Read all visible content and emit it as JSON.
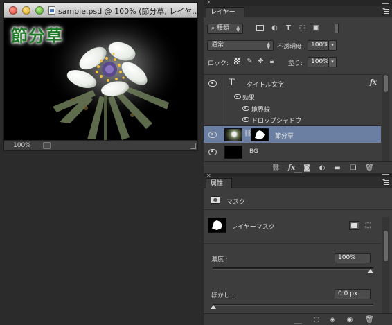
{
  "document": {
    "title": "sample.psd @ 100% (節分草, レイヤ…",
    "canvas_text": "節分草",
    "zoom": "100%"
  },
  "layers_panel": {
    "tab_label": "レイヤー",
    "filter_kind": "種類",
    "blend_mode": "通常",
    "opacity_label": "不透明度:",
    "opacity_value": "100%",
    "lock_label": "ロック:",
    "fill_label": "塗り:",
    "fill_value": "100%",
    "layers": [
      {
        "name": "タイトル文字",
        "kind": "text",
        "fx": "fx",
        "effects_label": "効果",
        "effects": [
          "境界線",
          "ドロップシャドウ"
        ]
      },
      {
        "name": "節分草",
        "kind": "image-with-mask",
        "selected": true
      },
      {
        "name": "BG",
        "kind": "fill"
      }
    ]
  },
  "properties_panel": {
    "tab_label": "属性",
    "title": "マスク",
    "mask_name": "レイヤーマスク",
    "density_label": "濃度 :",
    "density_value": "100%",
    "feather_label": "ぼかし :",
    "feather_value": "0.0 px"
  },
  "colors": {
    "selected_row": "#6b7fa3",
    "panel_bg": "#3d3d3d",
    "canvas_text": "#1f7a28"
  },
  "icons": {
    "doc_controls": [
      "close-icon",
      "minimize-icon",
      "zoom-icon"
    ],
    "filter": [
      "image-filter-icon",
      "adjustment-filter-icon",
      "type-filter-icon",
      "shape-filter-icon",
      "smart-object-filter-icon",
      "filter-toggle-icon"
    ],
    "lock": [
      "lock-transparent-icon",
      "lock-image-icon",
      "lock-position-icon",
      "lock-all-icon"
    ],
    "layers_footer": [
      "link-icon",
      "fx-icon",
      "add-mask-icon",
      "adjustment-layer-icon",
      "new-group-icon",
      "new-layer-icon",
      "trash-icon"
    ],
    "props_footer": [
      "load-selection-icon",
      "apply-mask-icon",
      "visibility-icon",
      "trash-icon"
    ]
  }
}
